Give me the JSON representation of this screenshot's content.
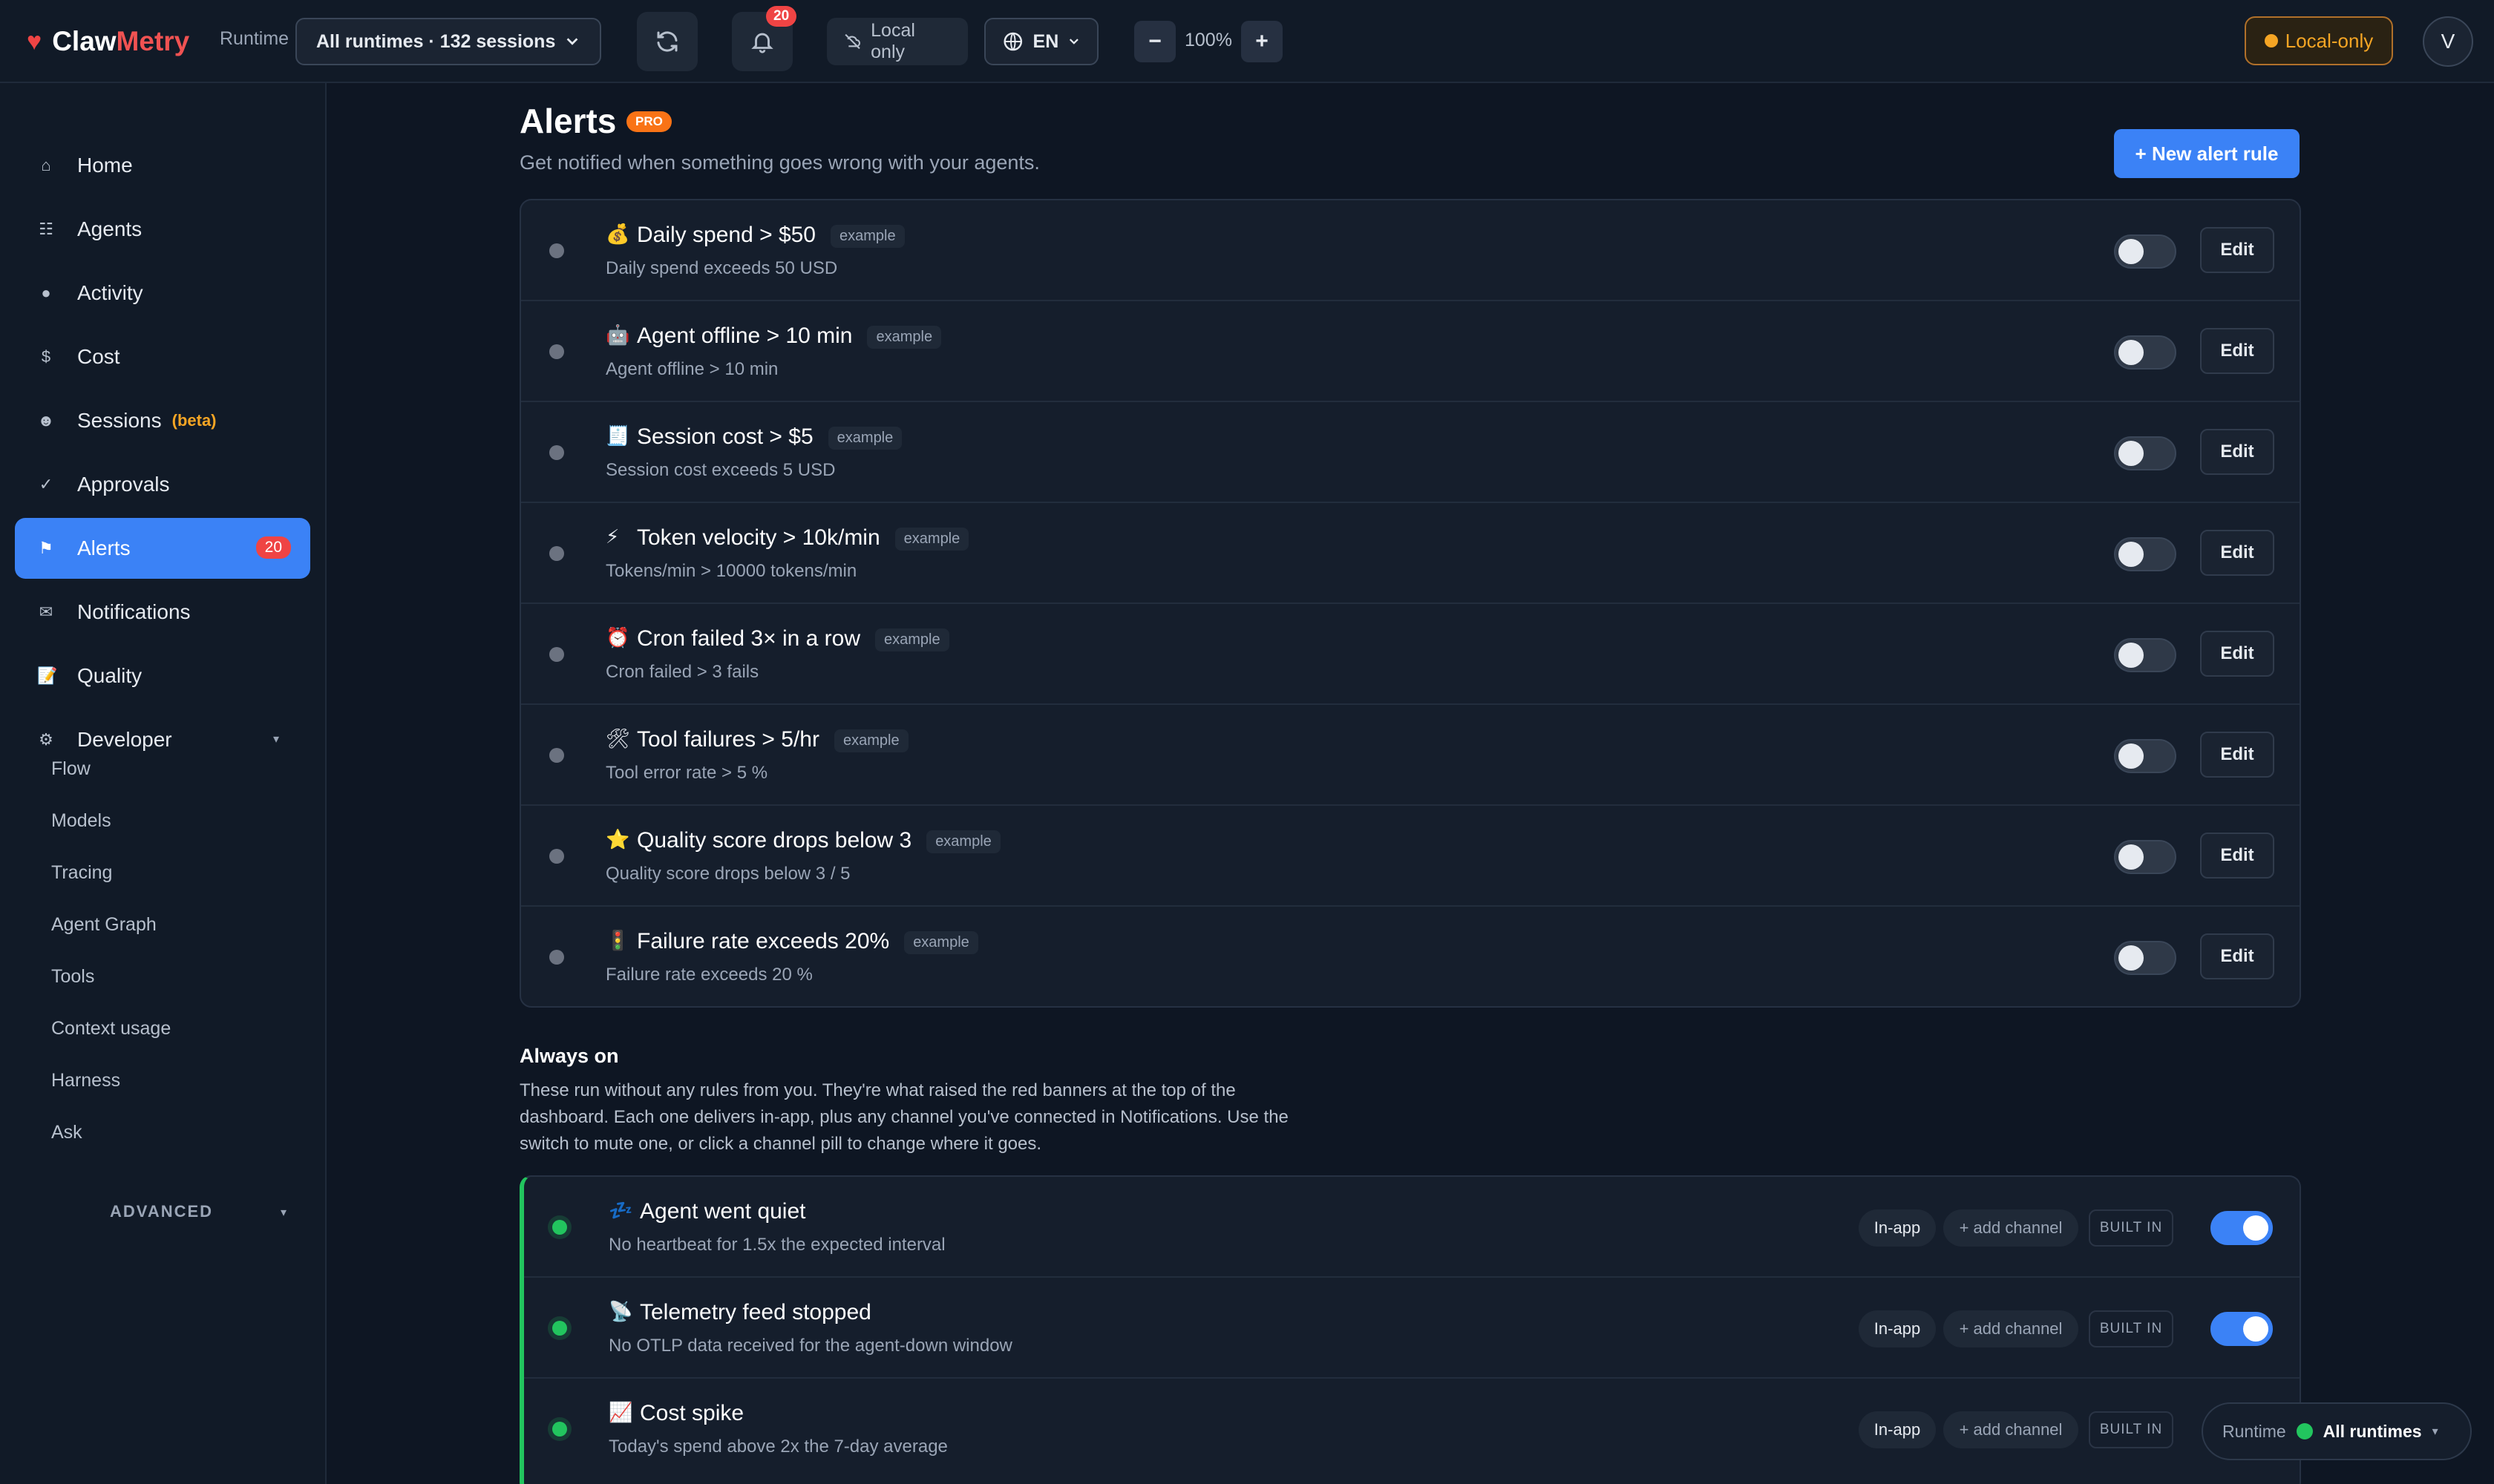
{
  "app": {
    "name_part1": "Claw",
    "name_part2": "Metry"
  },
  "header": {
    "runtime_label": "Runtime",
    "runtime_select": "All runtimes · 132 sessions",
    "notifications_count": "20",
    "local_only_pill": "Local only",
    "language": "EN",
    "zoom": "100%",
    "zoom_minus": "−",
    "zoom_plus": "+",
    "mode_badge": "Local-only",
    "avatar": "V"
  },
  "sidebar": {
    "items": [
      {
        "label": "Home",
        "icon": "⌂"
      },
      {
        "label": "Agents",
        "icon": "☷"
      },
      {
        "label": "Activity",
        "icon": "●"
      },
      {
        "label": "Cost",
        "icon": "$"
      },
      {
        "label": "Sessions",
        "icon": "☻",
        "tag": "(beta)"
      },
      {
        "label": "Approvals",
        "icon": "✓"
      },
      {
        "label": "Alerts",
        "icon": "⚑",
        "count": "20"
      },
      {
        "label": "Notifications",
        "icon": "✉"
      },
      {
        "label": "Quality",
        "icon": "📝"
      },
      {
        "label": "Developer",
        "icon": "⚙"
      }
    ],
    "developer_items": [
      "Flow",
      "Models",
      "Tracing",
      "Agent Graph",
      "Tools",
      "Context usage",
      "Harness",
      "Ask"
    ],
    "advanced_label": "ADVANCED"
  },
  "main": {
    "title": "Alerts",
    "pro_badge": "PRO",
    "subtitle": "Get notified when something goes wrong with your agents.",
    "new_button": "+ New alert rule",
    "example_tag": "example",
    "edit_label": "Edit",
    "rules": [
      {
        "emoji": "💰",
        "name": "Daily spend > $50",
        "desc": "Daily spend exceeds 50 USD",
        "enabled": false
      },
      {
        "emoji": "🤖",
        "name": "Agent offline > 10 min",
        "desc": "Agent offline > 10 min",
        "enabled": false
      },
      {
        "emoji": "🧾",
        "name": "Session cost > $5",
        "desc": "Session cost exceeds 5 USD",
        "enabled": false
      },
      {
        "emoji": "⚡",
        "name": "Token velocity > 10k/min",
        "desc": "Tokens/min > 10000 tokens/min",
        "enabled": false
      },
      {
        "emoji": "⏰",
        "name": "Cron failed 3× in a row",
        "desc": "Cron failed > 3 fails",
        "enabled": false
      },
      {
        "emoji": "🛠",
        "name": "Tool failures > 5/hr",
        "desc": "Tool error rate > 5 %",
        "enabled": false
      },
      {
        "emoji": "⭐",
        "name": "Quality score drops below 3",
        "desc": "Quality score drops below 3 / 5",
        "enabled": false
      },
      {
        "emoji": "🚦",
        "name": "Failure rate exceeds 20%",
        "desc": "Failure rate exceeds 20 %",
        "enabled": false
      }
    ],
    "always_on": {
      "title": "Always on",
      "desc": "These run without any rules from you. They're what raised the red banners at the top of the dashboard. Each one delivers in-app, plus any channel you've connected in Notifications. Use the switch to mute one, or click a channel pill to change where it goes.",
      "channel_inapp": "In-app",
      "add_channel": "+ add channel",
      "built_in": "BUILT IN",
      "items": [
        {
          "emoji": "💤",
          "name": "Agent went quiet",
          "desc": "No heartbeat for 1.5x the expected interval",
          "enabled": true
        },
        {
          "emoji": "📡",
          "name": "Telemetry feed stopped",
          "desc": "No OTLP data received for the agent-down window",
          "enabled": true
        },
        {
          "emoji": "📈",
          "name": "Cost spike",
          "desc": "Today's spend above 2x the 7-day average",
          "enabled": true
        }
      ]
    }
  },
  "runtime_float": {
    "label": "Runtime",
    "value": "All runtimes"
  },
  "colors": {
    "accent": "#3b82f6",
    "danger": "#ef4444",
    "warning": "#f5a524",
    "success": "#22c55e",
    "bg": "#0e1623"
  }
}
